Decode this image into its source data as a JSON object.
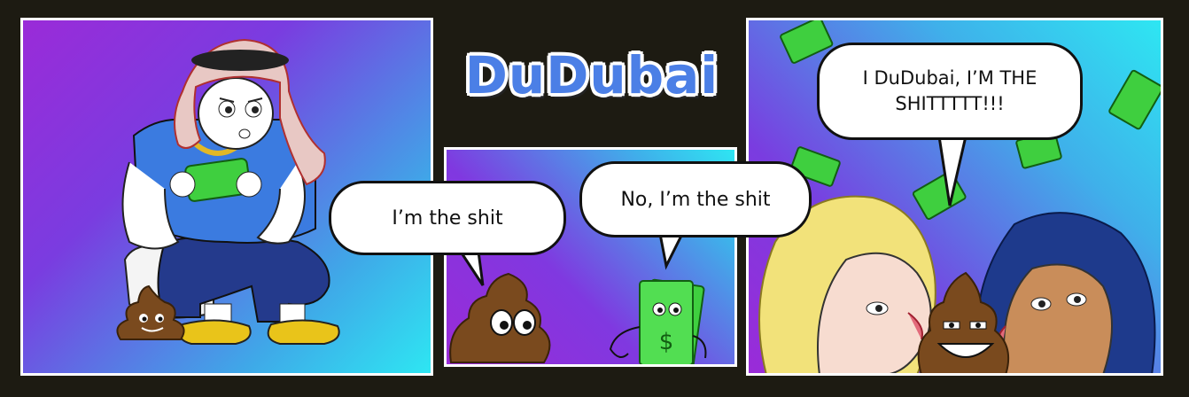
{
  "title": "DuDubai",
  "bubbles": {
    "poop": "I’m the shit",
    "money": "No, I’m the shit",
    "dudubai": "I DuDubai, I’M THE SHITTTTT!!!"
  },
  "colors": {
    "background": "#1d1b12",
    "title": "#4b7fe6",
    "shirt": "#3b7be0",
    "pants": "#243a8c",
    "shoes": "#e9c41a",
    "poop": "#7a4a1e",
    "money": "#3fcf3f"
  },
  "icons": [
    "poop-emoji-icon",
    "money-stack-icon",
    "falling-banknote-icon"
  ]
}
